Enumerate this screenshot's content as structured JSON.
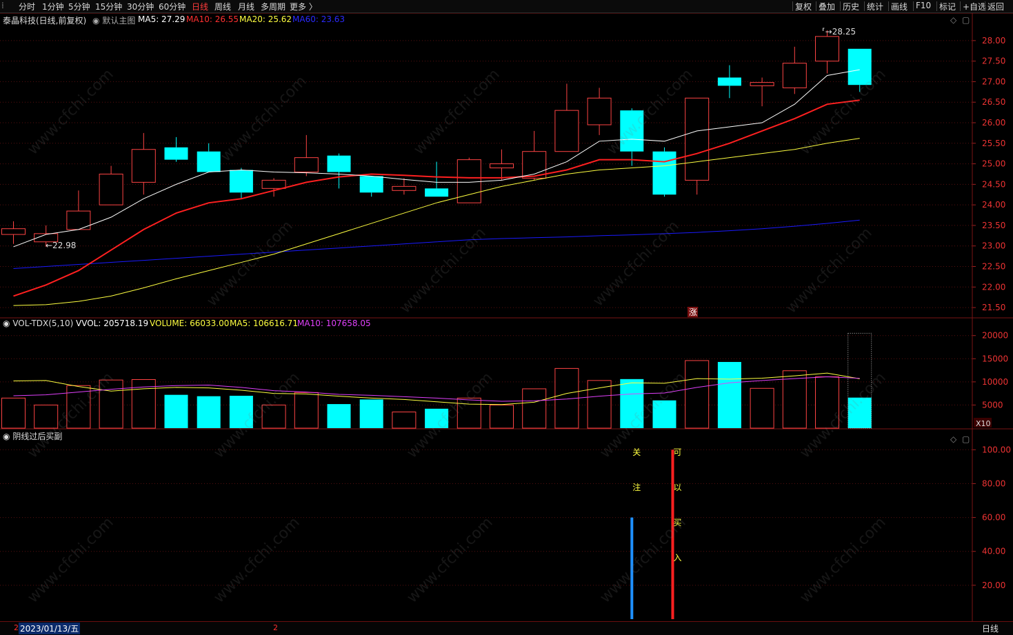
{
  "toolbar": {
    "left_items": [
      "分时",
      "1分钟",
      "5分钟",
      "15分钟",
      "30分钟",
      "60分钟",
      "日线",
      "周线",
      "月线",
      "多周期",
      "更多 〉"
    ],
    "active": "日线",
    "right_items": [
      "复权",
      "叠加",
      "历史",
      "统计",
      "画线",
      "F10",
      "标记",
      "+自选",
      "返回"
    ]
  },
  "price_panel": {
    "title": "泰晶科技(日线,前复权)",
    "main_label": "默认主图",
    "ma5": "MA5: 27.29",
    "ma10": "MA10: 26.55",
    "ma20": "MA20: 25.62",
    "ma60": "MA60: 23.63",
    "high_label": "28.25",
    "low_label": "22.98",
    "marker": "涨"
  },
  "volume_panel": {
    "title": "VOL-TDX(5,10)",
    "vvol": "VVOL: 205718.19",
    "volume": "VOLUME: 66033.00",
    "ma5": "MA5: 106616.71",
    "ma10": "MA10: 107658.05",
    "unit": "X10"
  },
  "indicator_panel": {
    "title": "阴线过后买副",
    "signal1": [
      "关",
      "注"
    ],
    "signal2": [
      "可",
      "以",
      "买",
      "入"
    ]
  },
  "bottom_bar": {
    "date": "2023/01/13/五",
    "marker": "2",
    "period": "日线"
  },
  "watermark": "www.cfchi.com",
  "colors": {
    "up": "#ff4444",
    "down": "#00ffff",
    "ma5": "#ffffff",
    "ma10": "#ff2020",
    "ma20": "#ffff40",
    "ma60": "#1a1aff",
    "vol_ma5": "#ffff40",
    "vol_ma10": "#e040fb",
    "signal_blue": "#1e90ff",
    "signal_red": "#ff2020"
  },
  "chart_data": [
    {
      "type": "candlestick",
      "title": "泰晶科技(日线,前复权)",
      "ylim": [
        21.3,
        28.35
      ],
      "yticks": [
        "21.50",
        "22.00",
        "22.50",
        "23.00",
        "23.50",
        "24.00",
        "24.50",
        "25.00",
        "25.50",
        "26.00",
        "26.50",
        "27.00",
        "27.50",
        "28.00"
      ],
      "candles": [
        {
          "o": 23.28,
          "c": 23.42,
          "h": 23.6,
          "l": 23.05
        },
        {
          "o": 23.1,
          "c": 23.3,
          "h": 23.5,
          "l": 22.98
        },
        {
          "o": 23.4,
          "c": 23.85,
          "h": 24.35,
          "l": 23.4
        },
        {
          "o": 24.0,
          "c": 24.75,
          "h": 24.95,
          "l": 24.0
        },
        {
          "o": 24.55,
          "c": 25.35,
          "h": 25.75,
          "l": 24.25
        },
        {
          "o": 25.4,
          "c": 25.1,
          "h": 25.65,
          "l": 25.05
        },
        {
          "o": 25.3,
          "c": 24.8,
          "h": 25.5,
          "l": 24.8
        },
        {
          "o": 24.85,
          "c": 24.3,
          "h": 24.9,
          "l": 24.15
        },
        {
          "o": 24.4,
          "c": 24.6,
          "h": 24.65,
          "l": 24.2
        },
        {
          "o": 24.8,
          "c": 25.15,
          "h": 25.7,
          "l": 24.7
        },
        {
          "o": 25.2,
          "c": 24.8,
          "h": 25.25,
          "l": 24.4
        },
        {
          "o": 24.7,
          "c": 24.3,
          "h": 24.7,
          "l": 24.2
        },
        {
          "o": 24.35,
          "c": 24.45,
          "h": 24.65,
          "l": 24.25
        },
        {
          "o": 24.4,
          "c": 24.2,
          "h": 25.05,
          "l": 24.2
        },
        {
          "o": 24.05,
          "c": 25.1,
          "h": 25.15,
          "l": 24.05
        },
        {
          "o": 24.9,
          "c": 25.0,
          "h": 25.35,
          "l": 24.6
        },
        {
          "o": 24.65,
          "c": 25.3,
          "h": 25.8,
          "l": 24.6
        },
        {
          "o": 25.3,
          "c": 26.3,
          "h": 26.95,
          "l": 25.3
        },
        {
          "o": 25.95,
          "c": 26.6,
          "h": 26.85,
          "l": 25.7
        },
        {
          "o": 26.3,
          "c": 25.3,
          "h": 26.35,
          "l": 24.95
        },
        {
          "o": 25.3,
          "c": 24.25,
          "h": 25.4,
          "l": 24.2
        },
        {
          "o": 24.6,
          "c": 26.6,
          "h": 26.6,
          "l": 24.25
        },
        {
          "o": 27.1,
          "c": 26.9,
          "h": 27.4,
          "l": 26.6
        },
        {
          "o": 26.9,
          "c": 26.98,
          "h": 27.1,
          "l": 26.4
        },
        {
          "o": 26.85,
          "c": 27.45,
          "h": 27.85,
          "l": 26.7
        },
        {
          "o": 27.5,
          "c": 28.1,
          "h": 28.25,
          "l": 27.2
        },
        {
          "o": 27.8,
          "c": 26.92,
          "h": 27.8,
          "l": 26.75
        }
      ],
      "ma5": [
        22.98,
        23.28,
        23.4,
        23.7,
        24.15,
        24.5,
        24.8,
        24.85,
        24.8,
        24.78,
        24.75,
        24.7,
        24.62,
        24.55,
        24.55,
        24.6,
        24.75,
        25.05,
        25.55,
        25.6,
        25.55,
        25.8,
        25.9,
        26.0,
        26.45,
        27.15,
        27.29
      ],
      "ma10": [
        21.78,
        22.05,
        22.4,
        22.9,
        23.4,
        23.8,
        24.05,
        24.15,
        24.35,
        24.55,
        24.68,
        24.75,
        24.72,
        24.68,
        24.66,
        24.66,
        24.7,
        24.85,
        25.1,
        25.1,
        25.05,
        25.25,
        25.5,
        25.8,
        26.1,
        26.45,
        26.55
      ],
      "ma20": [
        21.55,
        21.57,
        21.65,
        21.78,
        21.98,
        22.2,
        22.4,
        22.6,
        22.8,
        23.05,
        23.3,
        23.55,
        23.8,
        24.05,
        24.25,
        24.45,
        24.6,
        24.75,
        24.85,
        24.9,
        24.95,
        25.05,
        25.15,
        25.25,
        25.35,
        25.5,
        25.62
      ],
      "ma60": [
        22.45,
        22.5,
        22.55,
        22.6,
        22.65,
        22.7,
        22.75,
        22.8,
        22.85,
        22.9,
        22.95,
        23.0,
        23.05,
        23.1,
        23.15,
        23.18,
        23.2,
        23.22,
        23.25,
        23.27,
        23.3,
        23.33,
        23.37,
        23.42,
        23.48,
        23.55,
        23.63
      ]
    },
    {
      "type": "bar",
      "title": "VOL-TDX(5,10)",
      "unit": "X10",
      "ylim": [
        0,
        21000
      ],
      "yticks": [
        "5000",
        "10000",
        "15000",
        "20000"
      ],
      "volumes": [
        6500,
        5000,
        9200,
        10400,
        10500,
        7200,
        6900,
        7000,
        5000,
        7700,
        5200,
        6200,
        3500,
        4200,
        6500,
        5000,
        8500,
        12900,
        10300,
        10600,
        6000,
        14600,
        14300,
        8600,
        12400,
        11100,
        6600
      ],
      "vol_ma5": [
        10200,
        10300,
        9000,
        8000,
        8500,
        8800,
        8700,
        8200,
        7500,
        7400,
        6900,
        6500,
        6200,
        5700,
        5200,
        5100,
        5600,
        7500,
        8700,
        9800,
        9700,
        10700,
        10600,
        10800,
        11300,
        11900,
        10660
      ],
      "vol_ma10": [
        7000,
        7200,
        7800,
        8400,
        8900,
        9200,
        9300,
        8800,
        8100,
        7800,
        7300,
        7100,
        6800,
        6500,
        6100,
        5800,
        5900,
        6300,
        6900,
        7400,
        7600,
        8800,
        9800,
        10300,
        10700,
        11100,
        10770
      ]
    },
    {
      "type": "bar",
      "title": "阴线过后买副",
      "ylim": [
        0,
        105
      ],
      "yticks": [
        "20.00",
        "40.00",
        "60.00",
        "80.00",
        "100.00"
      ],
      "signals": [
        {
          "index": 19,
          "value": 60,
          "color": "blue",
          "text": "关注"
        },
        {
          "index": 20,
          "value": 100,
          "color": "red",
          "text": "可以买入"
        }
      ]
    }
  ]
}
